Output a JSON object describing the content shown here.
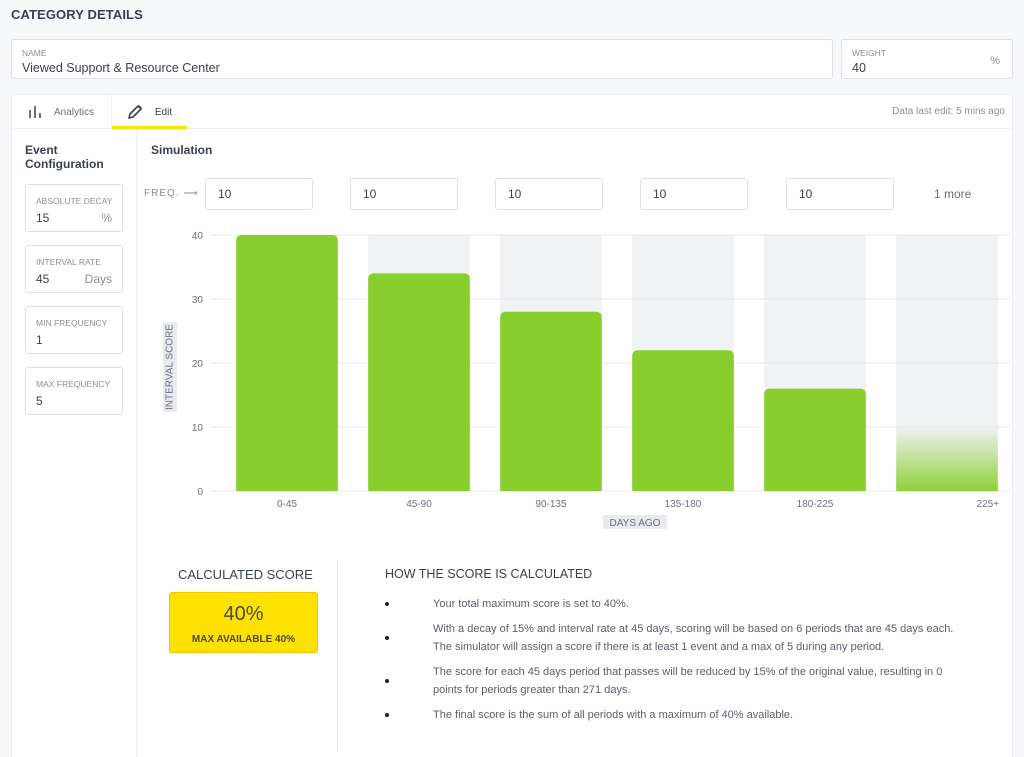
{
  "page": {
    "title": "CATEGORY DETAILS"
  },
  "name_field": {
    "label": "NAME",
    "value": "Viewed Support & Resource Center"
  },
  "weight_field": {
    "label": "WEIGHT",
    "value": "40",
    "unit": "%"
  },
  "tabs": [
    {
      "label": "Analytics",
      "icon": "bar-chart-icon",
      "active": false
    },
    {
      "label": "Edit",
      "icon": "pencil-icon",
      "active": true
    }
  ],
  "last_edit": "Data last edit: 5 mins ago",
  "event_config": {
    "title": "Event Configuration",
    "fields": [
      {
        "label": "ABSOLUTE DECAY",
        "value": "15",
        "unit": "%"
      },
      {
        "label": "INTERVAL RATE",
        "value": "45",
        "unit": "Days"
      },
      {
        "label": "MIN FREQUENCY",
        "value": "1",
        "unit": ""
      },
      {
        "label": "MAX FREQUENCY",
        "value": "5",
        "unit": ""
      }
    ]
  },
  "simulation": {
    "title": "Simulation",
    "freq_label": "FREQ. ⟶",
    "freq_values": [
      "10",
      "10",
      "10",
      "10",
      "10"
    ],
    "more_label": "1 more"
  },
  "chart_data": {
    "type": "bar",
    "categories": [
      "0-45",
      "45-90",
      "90-135",
      "135-180",
      "180-225",
      "225+"
    ],
    "values": [
      40,
      34,
      28,
      22,
      16,
      10
    ],
    "faded": [
      false,
      false,
      false,
      false,
      false,
      true
    ],
    "xlabel": "DAYS AGO",
    "ylabel": "INTERVAL SCORE",
    "ylim": [
      0,
      40
    ],
    "yticks": [
      0,
      10,
      20,
      30,
      40
    ],
    "grid": true,
    "colors": {
      "bar": "#88cf2e",
      "track": "#f1f2f4",
      "grid": "#e6e8ec"
    }
  },
  "calculated": {
    "title": "CALCULATED SCORE",
    "score": "40%",
    "max_label": "MAX AVAILABLE 40%"
  },
  "how": {
    "title": "HOW THE SCORE IS CALCULATED",
    "items": [
      "Your total maximum score is set to 40%.",
      "With a decay of 15% and interval rate at 45 days, scoring will be based on 6 periods that are 45 days each. The simulator will assign a score if there is at least 1 event and a max of 5 during any period.",
      "The score for each 45 days period that passes will be reduced by 15% of the original value, resulting in 0 points for periods greater than 271 days.",
      "The final score is the sum of all periods with a maximum of 40% available."
    ]
  }
}
